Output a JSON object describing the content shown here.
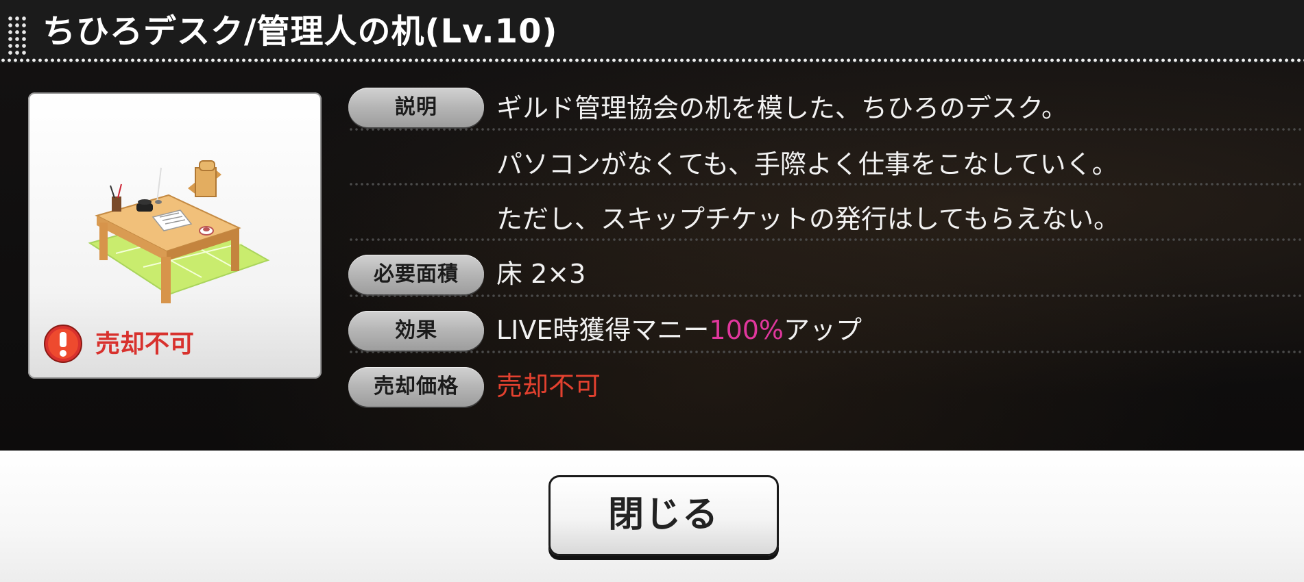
{
  "header": {
    "title": "ちひろデスク/管理人の机(Lv.10)"
  },
  "item": {
    "icon": "desk-furniture-image",
    "status_icon": "exclamation-icon",
    "status_label": "売却不可"
  },
  "details": {
    "description_label": "説明",
    "description_lines": [
      "ギルド管理協会の机を模した、ちひろのデスク。",
      "パソコンがなくても、手際よく仕事をこなしていく。",
      "ただし、スキップチケットの発行はしてもらえない。"
    ],
    "area_label": "必要面積",
    "area_value": "床 2×3",
    "effect_label": "効果",
    "effect_prefix": "LIVE時獲得マニー",
    "effect_highlight": "100%",
    "effect_suffix": "アップ",
    "price_label": "売却価格",
    "price_value": "売却不可"
  },
  "footer": {
    "close_label": "閉じる"
  },
  "colors": {
    "accent_magenta": "#e0379d",
    "warning_red": "#e3412f",
    "panel_bg": "#141212"
  }
}
